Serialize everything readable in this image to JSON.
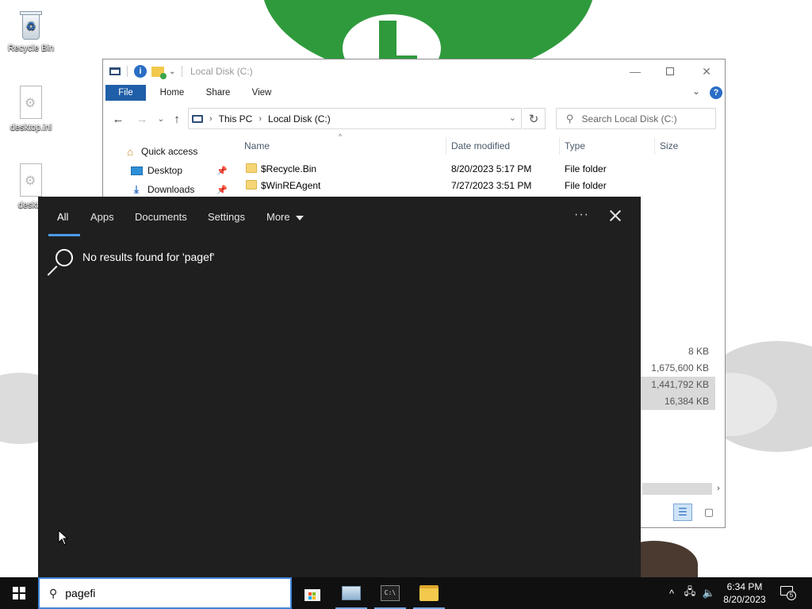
{
  "desktop": {
    "icons": [
      {
        "label": "Recycle Bin"
      },
      {
        "label": "desktop.ini"
      },
      {
        "label": "deskto"
      }
    ]
  },
  "explorer": {
    "title": "Local Disk (C:)",
    "ribbon_tabs": [
      "File",
      "Home",
      "Share",
      "View"
    ],
    "breadcrumb": [
      "This PC",
      "Local Disk (C:)"
    ],
    "search_placeholder": "Search Local Disk (C:)",
    "nav_pane": [
      {
        "label": "Quick access"
      },
      {
        "label": "Desktop"
      },
      {
        "label": "Downloads"
      }
    ],
    "columns": [
      "Name",
      "Date modified",
      "Type",
      "Size"
    ],
    "rows": [
      {
        "name": "$Recycle.Bin",
        "date": "8/20/2023 5:17 PM",
        "type": "File folder"
      },
      {
        "name": "$WinREAgent",
        "date": "7/27/2023 3:51 PM",
        "type": "File folder"
      }
    ],
    "visible_sizes": [
      {
        "value": "8 KB",
        "selected": false
      },
      {
        "value": "1,675,600 KB",
        "selected": false
      },
      {
        "value": "1,441,792 KB",
        "selected": true
      },
      {
        "value": "16,384 KB",
        "selected": true
      }
    ]
  },
  "search_panel": {
    "tabs": [
      "All",
      "Apps",
      "Documents",
      "Settings",
      "More"
    ],
    "active_tab": "All",
    "message": "No results found for 'pagef'"
  },
  "taskbar": {
    "search_value": "pagefi",
    "apps": [
      {
        "icon": "store-icon",
        "running": false
      },
      {
        "icon": "control-panel-icon",
        "running": true
      },
      {
        "icon": "command-prompt-icon",
        "running": true
      },
      {
        "icon": "file-explorer-icon",
        "running": true
      }
    ],
    "cmd_glyph": "C:\\",
    "clock_time": "6:34 PM",
    "clock_date": "8/20/2023",
    "notification_count": "5"
  },
  "colors": {
    "accent": "#3f84d6",
    "flyout_bg": "#1f1f1f",
    "taskbar_bg": "#101010",
    "ribbon_file": "#1f5ea8"
  }
}
